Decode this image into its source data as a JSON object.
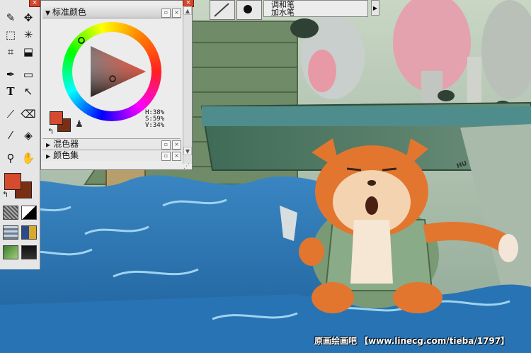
{
  "colors": {
    "foreground": "#d64a2e",
    "background": "#7a2e14",
    "sea": "#2a6fa8",
    "hull": "#3e6a55"
  },
  "toolbox": {
    "tools": [
      "brush-icon",
      "move-select-icon",
      "marquee-icon",
      "magic-wand-icon",
      "crop-icon",
      "transform-icon",
      "pen-icon",
      "rectangle-icon",
      "text-icon",
      "pointer-icon",
      "dropper-smudge-icon",
      "eraser-icon",
      "eyedropper-icon",
      "bucket-icon",
      "zoom-icon",
      "hand-icon"
    ]
  },
  "color_panel": {
    "title": "标准颜色",
    "hsv": {
      "h": "H:38%",
      "s": "S:59%",
      "v": "V:34%"
    },
    "sections": [
      "混色器",
      "颜色集"
    ]
  },
  "brush_bar": {
    "items": [
      "调和笔",
      "加水笔"
    ]
  },
  "scene": {
    "speech_tag": "HU"
  },
  "watermark": "原画绘画吧 【www.linecg.com/tieba/1797】"
}
